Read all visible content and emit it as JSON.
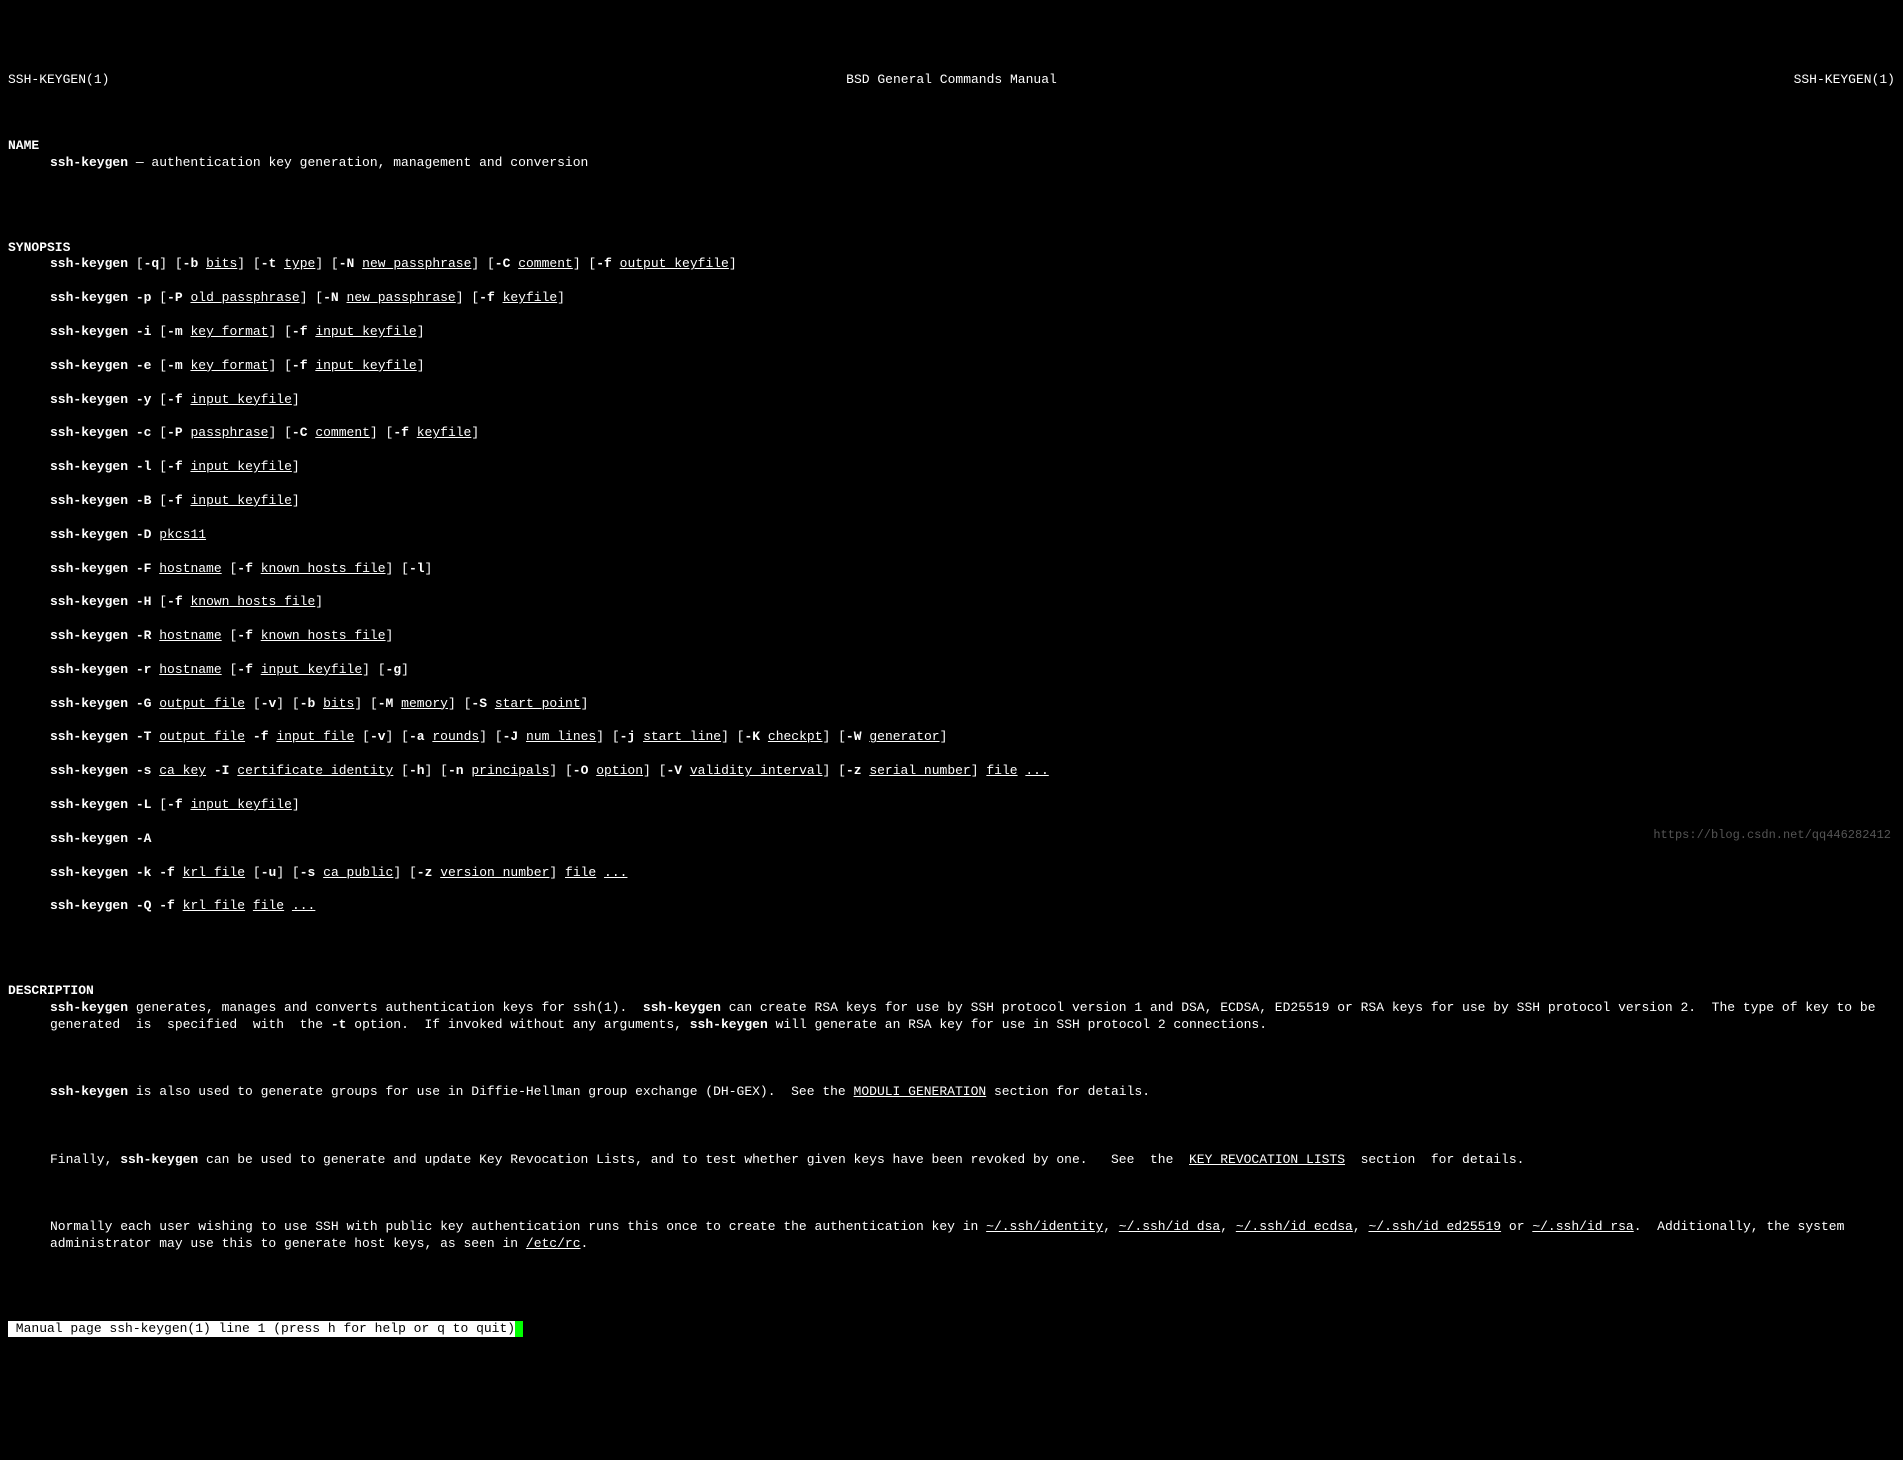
{
  "header": {
    "left": "SSH-KEYGEN(1)",
    "center": "BSD General Commands Manual",
    "right": "SSH-KEYGEN(1)"
  },
  "sections": {
    "name": {
      "title": "NAME",
      "cmd": "ssh-keygen",
      "desc": " — authentication key generation, management and conversion"
    },
    "synopsis": {
      "title": "SYNOPSIS"
    },
    "description": {
      "title": "DESCRIPTION"
    }
  },
  "syn": {
    "cmd": "ssh-keygen",
    "q": "-q",
    "b": "-b",
    "bits": "bits",
    "t": "-t",
    "type": "type",
    "N": "-N",
    "new_pass": "new_passphrase",
    "C": "-C",
    "comment": "comment",
    "f": "-f",
    "output_keyfile": "output_keyfile",
    "p": "-p",
    "P": "-P",
    "old_pass": "old_passphrase",
    "keyfile": "keyfile",
    "i": "-i",
    "m": "-m",
    "key_format": "key_format",
    "input_keyfile": "input_keyfile",
    "e": "-e",
    "y": "-y",
    "c": "-c",
    "passphrase": "passphrase",
    "l": "-l",
    "B": "-B",
    "D": "-D",
    "pkcs11": "pkcs11",
    "F": "-F",
    "hostname": "hostname",
    "known_hosts": "known_hosts_file",
    "H": "-H",
    "R": "-R",
    "r": "-r",
    "g": "-g",
    "G": "-G",
    "output_file": "output_file",
    "v": "-v",
    "M": "-M",
    "memory": "memory",
    "S": "-S",
    "start_point": "start_point",
    "T": "-T",
    "input_file": "input_file",
    "a": "-a",
    "rounds": "rounds",
    "J": "-J",
    "num_lines": "num_lines",
    "j": "-j",
    "start_line": "start_line",
    "K": "-K",
    "checkpt": "checkpt",
    "W": "-W",
    "generator": "generator",
    "s": "-s",
    "ca_key": "ca_key",
    "I": "-I",
    "cert_id": "certificate_identity",
    "h": "-h",
    "n": "-n",
    "principals": "principals",
    "O": "-O",
    "option": "option",
    "V": "-V",
    "validity": "validity_interval",
    "z": "-z",
    "serial": "serial_number",
    "file": "file",
    "dots": "...",
    "L": "-L",
    "A": "-A",
    "k": "-k",
    "krl_file": "krl_file",
    "u": "-u",
    "ca_public": "ca_public",
    "version": "version_number",
    "Q": "-Q"
  },
  "desc": {
    "p1a": " generates, manages and converts authentication keys for ssh(1).  ",
    "p1b": " can create RSA keys for use by SSH protocol version 1 and DSA, ECDSA, ED25519 or RSA keys for use by SSH protocol version 2.  The type of key to be  generated  is  specified  with  the ",
    "t_opt": "-t",
    "p1c": " option.  If invoked without any arguments, ",
    "p1d": " will generate an RSA key for use in SSH protocol 2 connections.",
    "p2a": " is also used to generate groups for use in Diffie-Hellman group exchange (DH-GEX).  See the ",
    "moduli": "MODULI GENERATION",
    "p2b": " section for details.",
    "p3a": "Finally, ",
    "p3b": " can be used to generate and update Key Revocation Lists, and to test whether given keys have been revoked by one.   See  the  ",
    "krl": "KEY REVOCATION LISTS",
    "p3c": "  section  for details.",
    "p4a": "Normally each user wishing to use SSH with public key authentication runs this once to create the authentication key in ",
    "path1": "~/.ssh/identity",
    "path2": "~/.ssh/id_dsa",
    "path3": "~/.ssh/id_ecdsa",
    "path4": "~/.ssh/id_ed25519",
    "p4b": " or ",
    "path5": "~/.ssh/id_rsa",
    "p4c": ".  Additionally, the system administrator may use this to generate host keys, as seen in ",
    "path6": "/etc/rc",
    "p4d": "."
  },
  "status": " Manual page ssh-keygen(1) line 1 (press h for help or q to quit)",
  "watermark": "https://blog.csdn.net/qq446282412"
}
